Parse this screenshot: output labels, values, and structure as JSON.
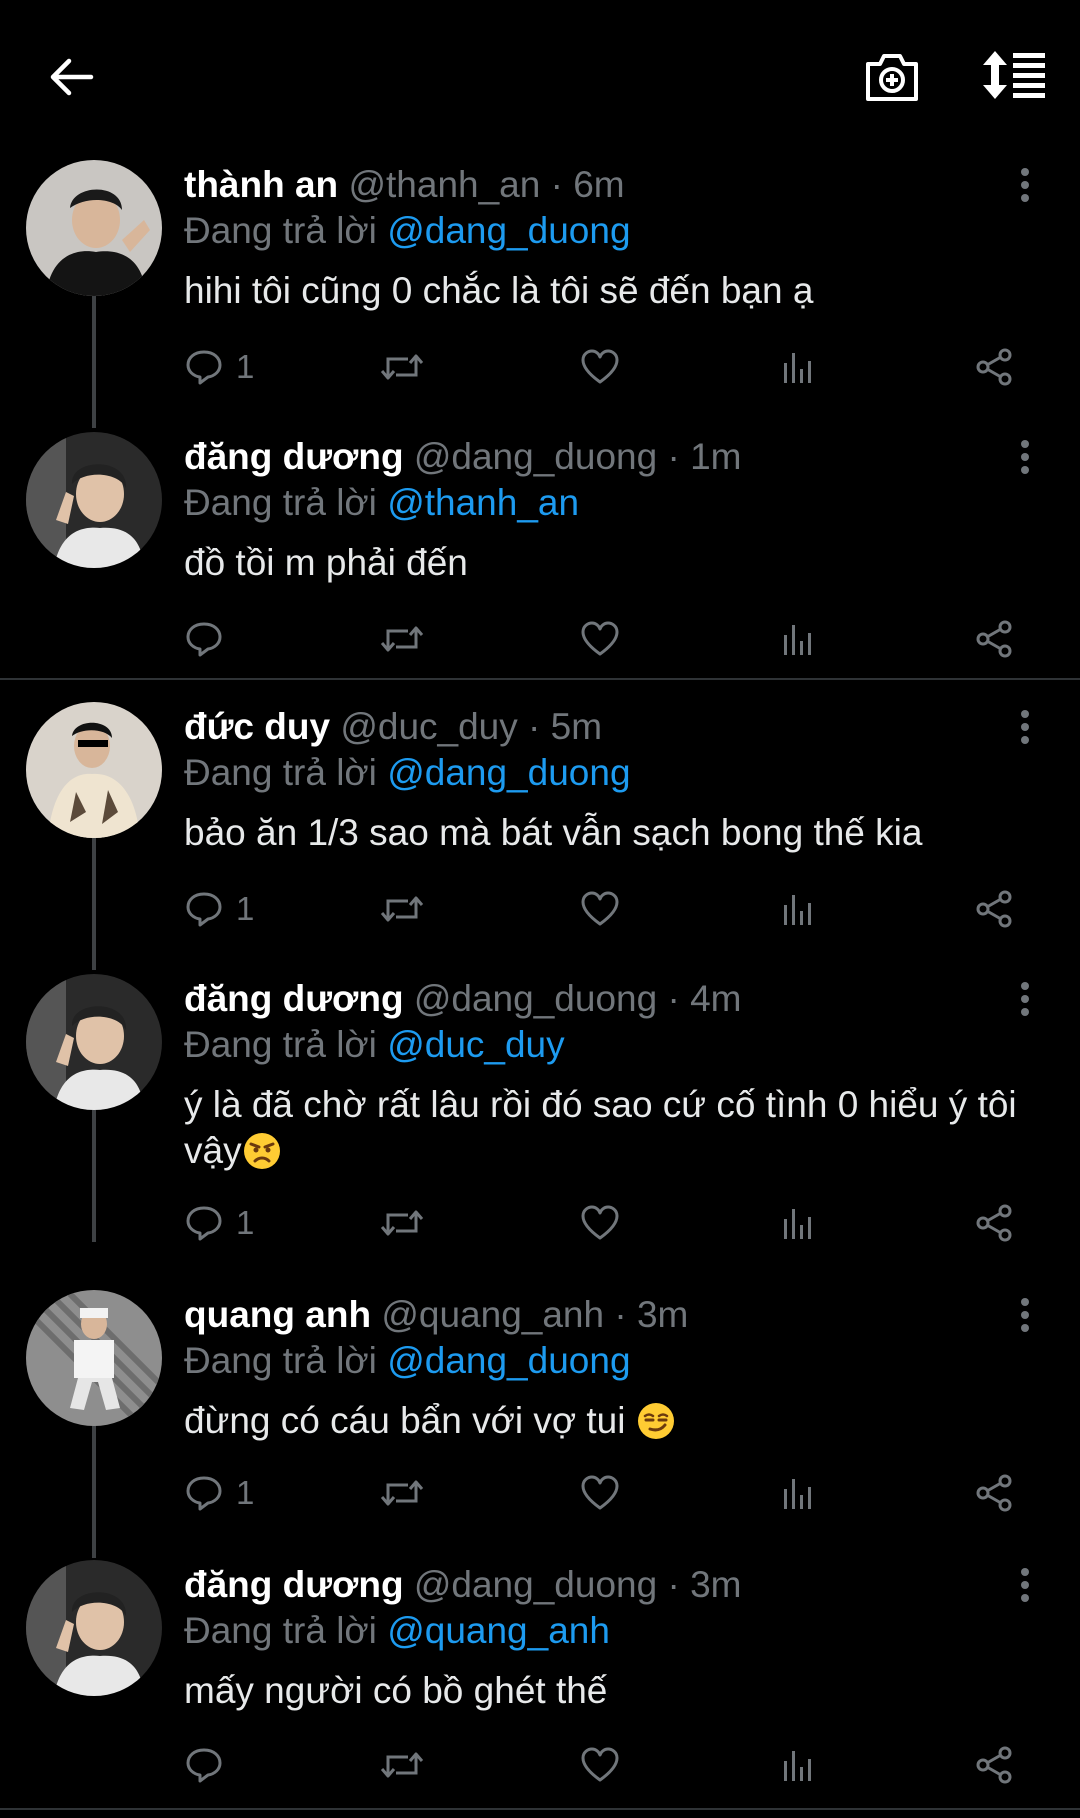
{
  "colors": {
    "background": "#000000",
    "text": "#e7e9ea",
    "muted": "#71767b",
    "accent": "#1d9bf0",
    "thread_line": "#3e4144"
  },
  "topbar": {
    "back_icon": "arrow-left-icon",
    "camera_icon": "camera-plus-icon",
    "sort_icon": "sort-list-icon"
  },
  "reply_prefix": "Đang trả lời",
  "tweets": [
    {
      "name": "thành an",
      "handle": "@thanh_an",
      "separator": "·",
      "time": "6m",
      "reply_to": "@dang_duong",
      "text": "hihi tôi cũng 0 chắc là tôi sẽ đến bạn ạ",
      "reply_count": "1"
    },
    {
      "name": "đăng dương",
      "handle": "@dang_duong",
      "separator": "·",
      "time": "1m",
      "reply_to": "@thanh_an",
      "text": "đồ tồi m phải đến",
      "reply_count": ""
    },
    {
      "name": "đức duy",
      "handle": "@duc_duy",
      "separator": "·",
      "time": "5m",
      "reply_to": "@dang_duong",
      "text": "bảo ăn 1/3 sao mà bát vẫn sạch bong thế kia",
      "reply_count": "1"
    },
    {
      "name": "đăng dương",
      "handle": "@dang_duong",
      "separator": "·",
      "time": "4m",
      "reply_to": "@duc_duy",
      "text": "ý là đã chờ rất lâu rồi đó sao cứ cố tình 0 hiểu ý tôi vậy",
      "emoji": "angry-face-emoji",
      "reply_count": "1"
    },
    {
      "name": "quang anh",
      "handle": "@quang_anh",
      "separator": "·",
      "time": "3m",
      "reply_to": "@dang_duong",
      "text": "đừng có cáu bẩn với vợ tui ",
      "emoji": "smirking-face-emoji",
      "reply_count": "1"
    },
    {
      "name": "đăng dương",
      "handle": "@dang_duong",
      "separator": "·",
      "time": "3m",
      "reply_to": "@quang_anh",
      "text": "mấy người có bồ ghét thế",
      "reply_count": ""
    }
  ]
}
